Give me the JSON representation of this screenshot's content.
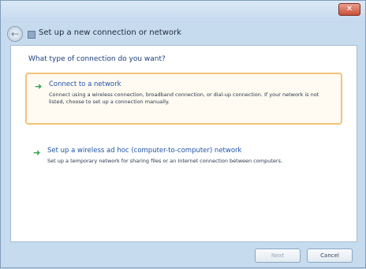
{
  "window": {
    "close_label": "✕"
  },
  "nav": {
    "back_label": "←",
    "title": "Set up a new connection or network"
  },
  "dialog": {
    "question": "What type of connection do you want?",
    "option1": {
      "title": "Connect to a network",
      "description": "Connect using a wireless connection, broadband connection, or dial-up connection. If your network is not listed, choose to set up a connection manually."
    },
    "option2": {
      "title": "Set up a wireless ad hoc (computer-to-computer) network",
      "description": "Set up a temporary network for sharing files or an Internet connection between computers."
    }
  },
  "footer": {
    "next_label": "Next",
    "cancel_label": "Cancel"
  }
}
